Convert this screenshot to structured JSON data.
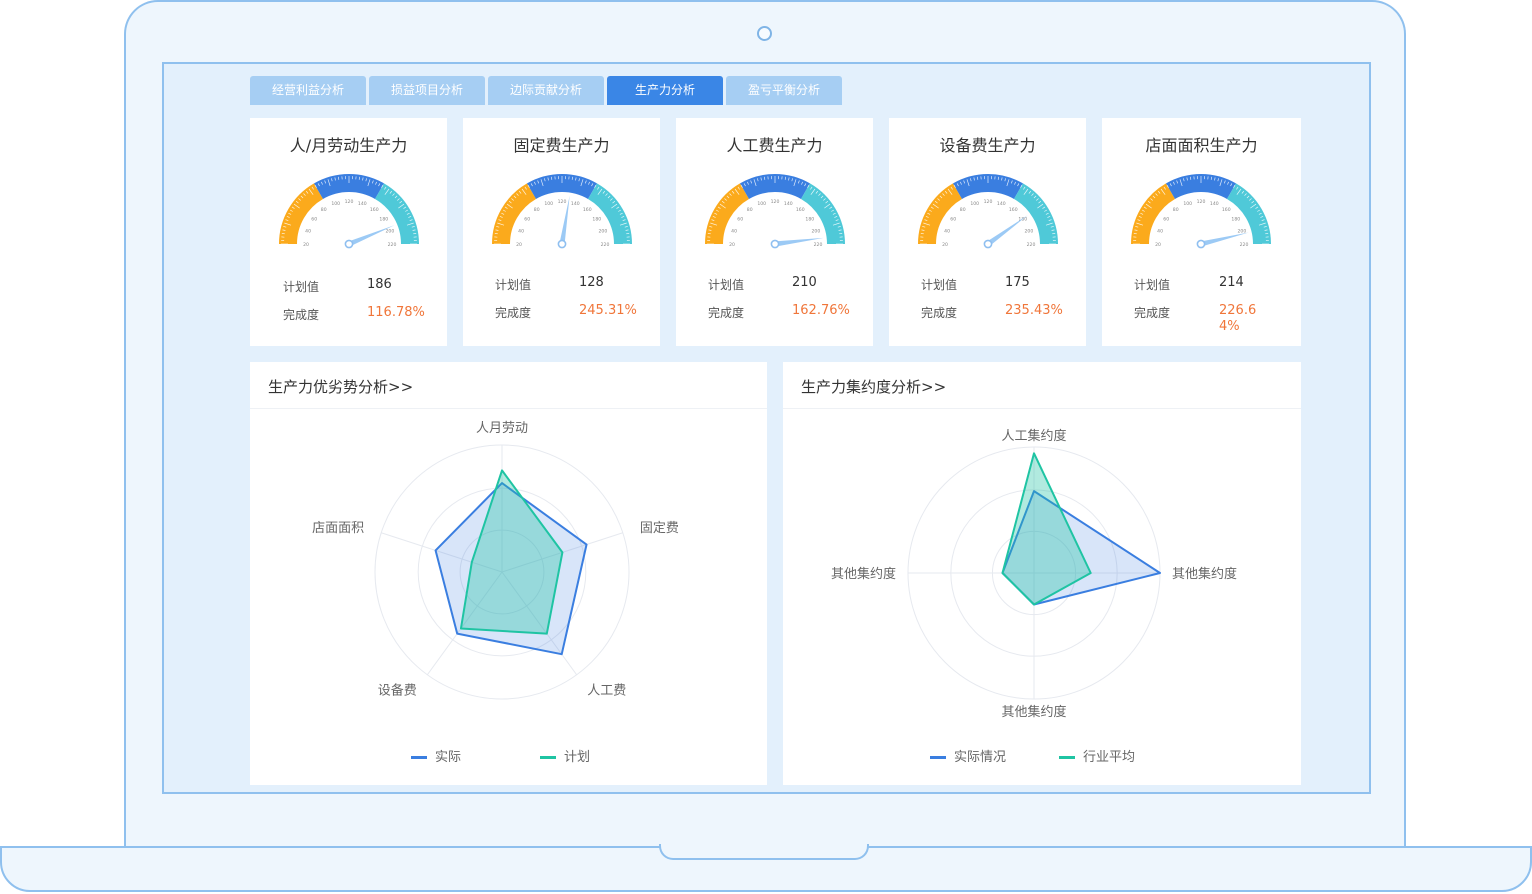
{
  "tabs": [
    {
      "label": "经营利益分析",
      "active": false
    },
    {
      "label": "损益项目分析",
      "active": false
    },
    {
      "label": "边际贡献分析",
      "active": false
    },
    {
      "label": "生产力分析",
      "active": true
    },
    {
      "label": "盈亏平衡分析",
      "active": false
    }
  ],
  "kpi_common": {
    "plan_label": "计划值",
    "completion_label": "完成度"
  },
  "gauge_scale": {
    "ticks": [
      "20",
      "40",
      "60",
      "80",
      "100",
      "120",
      "140",
      "160",
      "180",
      "200",
      "220"
    ],
    "min": 20,
    "max": 220
  },
  "kpis": [
    {
      "title": "人/月劳动生产力",
      "plan": "186",
      "completion": "116.78%",
      "pointer": 195
    },
    {
      "title": "固定费生产力",
      "plan": "128",
      "completion": "245.31%",
      "pointer": 130
    },
    {
      "title": "人工费生产力",
      "plan": "210",
      "completion": "162.76%",
      "pointer": 212
    },
    {
      "title": "设备费生产力",
      "plan": "175",
      "completion": "235.43%",
      "pointer": 180
    },
    {
      "title": "店面面积生产力",
      "plan": "214",
      "completion": "226.64%",
      "pointer": 205
    }
  ],
  "colors": {
    "accent": "#3a86e6",
    "orange": "#fbaa1c",
    "blue": "#3a7ee0",
    "teal": "#4fc9d8",
    "green": "#1fc4a3",
    "completion": "#f0763a"
  },
  "panel_left": {
    "title": "生产力优劣势分析>>",
    "chart_data": {
      "type": "radar",
      "indicators": [
        "人月劳动",
        "固定费",
        "人工费",
        "设备费",
        "店面面积"
      ],
      "max": 100,
      "series": [
        {
          "name": "实际",
          "values": [
            70,
            70,
            80,
            60,
            55
          ]
        },
        {
          "name": "计划",
          "values": [
            80,
            50,
            60,
            55,
            25
          ]
        }
      ]
    }
  },
  "panel_right": {
    "title": "生产力集约度分析>>",
    "chart_data": {
      "type": "radar",
      "indicators": [
        "人工集约度",
        "其他集约度",
        "其他集约度",
        "其他集约度"
      ],
      "max": 100,
      "series": [
        {
          "name": "实际情况",
          "values": [
            65,
            100,
            25,
            25
          ]
        },
        {
          "name": "行业平均",
          "values": [
            95,
            45,
            25,
            25
          ]
        }
      ]
    }
  }
}
